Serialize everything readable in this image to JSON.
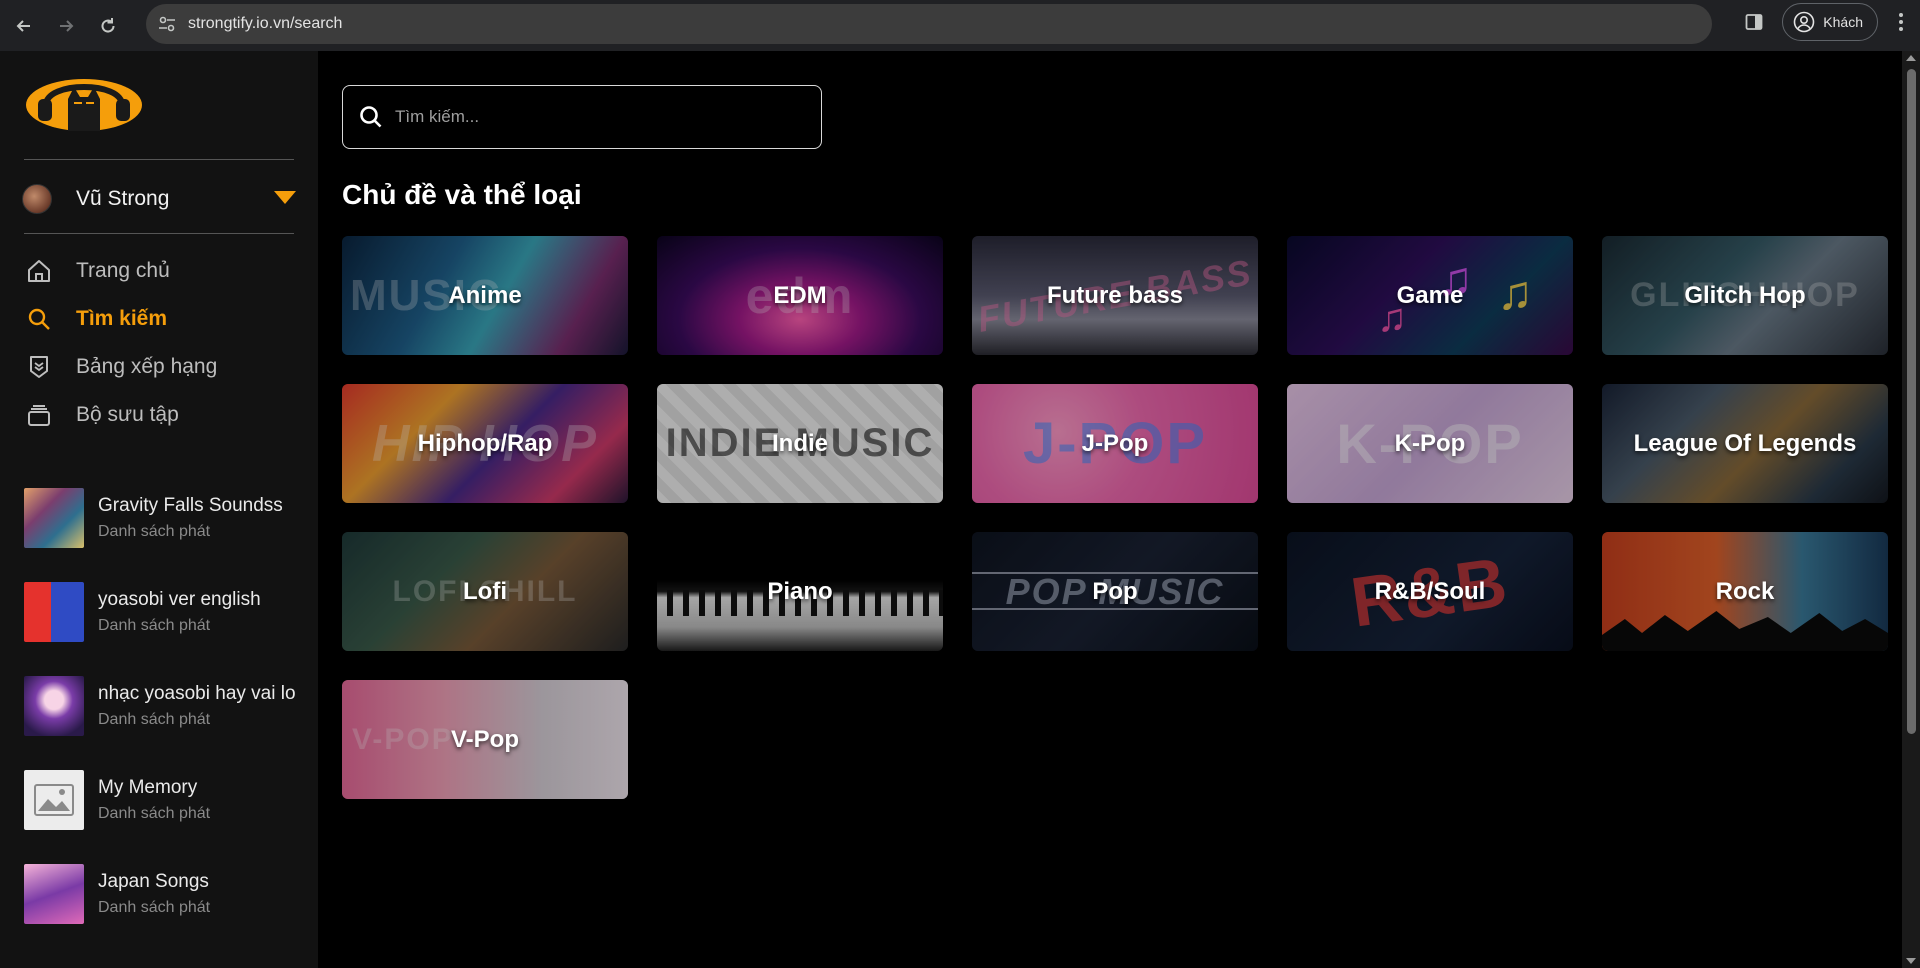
{
  "browser": {
    "url": "strongtify.io.vn/search",
    "profile_label": "Khách"
  },
  "sidebar": {
    "user": {
      "name": "Vũ Strong"
    },
    "menu": [
      {
        "label": "Trang chủ",
        "icon": "home-icon",
        "active": false
      },
      {
        "label": "Tìm kiếm",
        "icon": "search-icon",
        "active": true
      },
      {
        "label": "Bảng xếp hạng",
        "icon": "ranking-icon",
        "active": false
      },
      {
        "label": "Bộ sưu tập",
        "icon": "collection-icon",
        "active": false
      }
    ],
    "playlists": [
      {
        "title": "Gravity Falls Soundss",
        "subtitle": "Danh sách phát"
      },
      {
        "title": "yoasobi ver english",
        "subtitle": "Danh sách phát"
      },
      {
        "title": "nhạc yoasobi hay vai lo",
        "subtitle": "Danh sách phát"
      },
      {
        "title": "My Memory",
        "subtitle": "Danh sách phát"
      },
      {
        "title": "Japan Songs",
        "subtitle": "Danh sách phát"
      }
    ]
  },
  "search": {
    "placeholder": "Tìm kiếm..."
  },
  "section": {
    "title": "Chủ đề và thể loại"
  },
  "genres": [
    {
      "label": "Anime",
      "bg_text": "MUSIC"
    },
    {
      "label": "EDM",
      "bg_text": "edm"
    },
    {
      "label": "Future bass",
      "bg_text": "FUTURE BASS"
    },
    {
      "label": "Game",
      "bg_text": ""
    },
    {
      "label": "Glitch Hop",
      "bg_text": "GLITCH HOP"
    },
    {
      "label": "Hiphop/Rap",
      "bg_text": "HIP HOP"
    },
    {
      "label": "Indie",
      "bg_text": "INDIE MUSIC"
    },
    {
      "label": "J-Pop",
      "bg_text": "J-POP"
    },
    {
      "label": "K-Pop",
      "bg_text": "K-POP"
    },
    {
      "label": "League Of Legends",
      "bg_text": ""
    },
    {
      "label": "Lofi",
      "bg_text": "LOFI CHILL"
    },
    {
      "label": "Piano",
      "bg_text": ""
    },
    {
      "label": "Pop",
      "bg_text": "POP MUSIC"
    },
    {
      "label": "R&B/Soul",
      "bg_text": "R&B"
    },
    {
      "label": "Rock",
      "bg_text": ""
    },
    {
      "label": "V-Pop",
      "bg_text": "V-POP"
    }
  ],
  "colors": {
    "accent": "#f59e0b",
    "sidebar_bg": "#121212",
    "main_bg": "#000000"
  }
}
